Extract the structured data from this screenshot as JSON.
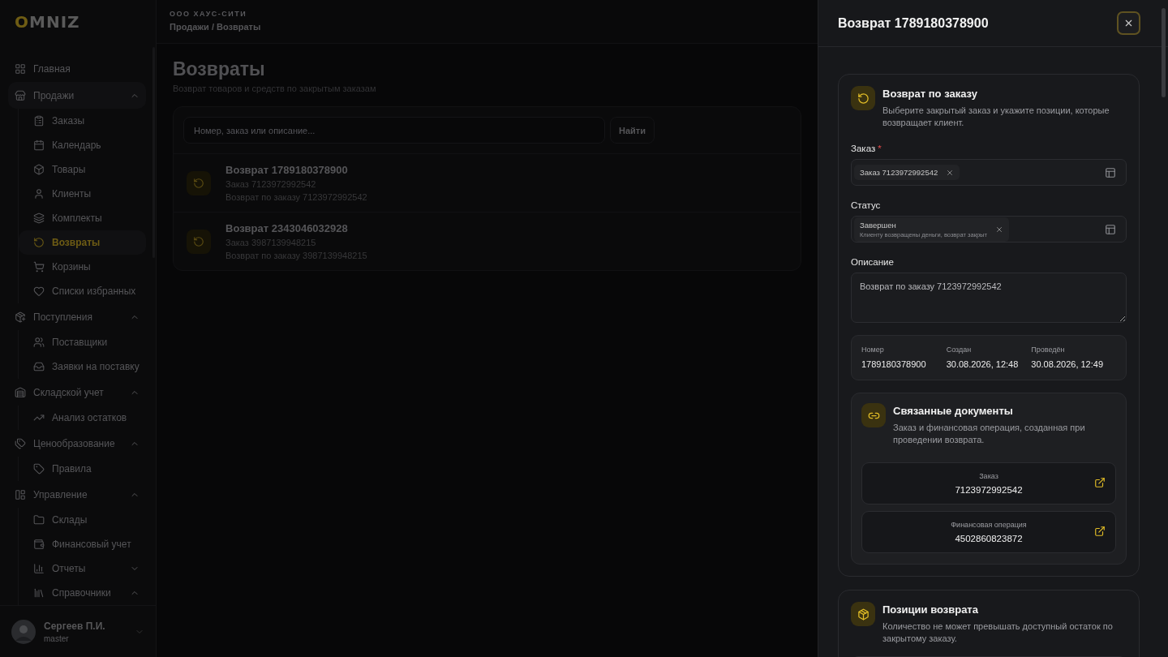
{
  "logo": {
    "accent": "O",
    "rest": "MNIZ"
  },
  "sidebar": {
    "items": [
      {
        "label": "Главная",
        "selected": false
      },
      {
        "label": "Продажи",
        "selected": false,
        "expanded": true,
        "children": [
          {
            "label": "Заказы",
            "selected": false
          },
          {
            "label": "Календарь",
            "selected": false
          },
          {
            "label": "Товары",
            "selected": false
          },
          {
            "label": "Клиенты",
            "selected": false
          },
          {
            "label": "Комплекты",
            "selected": false
          },
          {
            "label": "Возвраты",
            "selected": true
          },
          {
            "label": "Корзины",
            "selected": false
          },
          {
            "label": "Списки избранных",
            "selected": false
          }
        ]
      },
      {
        "label": "Поступления",
        "selected": false,
        "expanded": true,
        "children": [
          {
            "label": "Поставщики",
            "selected": false
          },
          {
            "label": "Заявки на поставку",
            "selected": false
          }
        ]
      },
      {
        "label": "Складской учет",
        "selected": false,
        "expanded": true,
        "children": [
          {
            "label": "Анализ остатков",
            "selected": false
          }
        ]
      },
      {
        "label": "Ценообразование",
        "selected": false,
        "expanded": true,
        "children": [
          {
            "label": "Правила",
            "selected": false
          }
        ]
      },
      {
        "label": "Управление",
        "selected": false,
        "expanded": true,
        "children": [
          {
            "label": "Склады",
            "selected": false
          },
          {
            "label": "Финансовый учет",
            "selected": false
          },
          {
            "label": "Отчеты",
            "selected": false,
            "expanded": false
          },
          {
            "label": "Справочники",
            "selected": false,
            "expanded": true
          }
        ]
      }
    ]
  },
  "user": {
    "name": "Сергеев П.И.",
    "role": "master"
  },
  "header": {
    "company": "ООО ХАУС-СИТИ",
    "breadcrumb": "Продажи / Возвраты"
  },
  "page": {
    "title": "Возвраты",
    "subtitle": "Возврат товаров и средств по закрытым заказам"
  },
  "search": {
    "placeholder": "Номер, заказ или описание...",
    "button": "Найти"
  },
  "returns": [
    {
      "title": "Возврат 1789180378900",
      "order": "Заказ 7123972992542",
      "description": "Возврат по заказу 7123972992542"
    },
    {
      "title": "Возврат 2343046032928",
      "order": "Заказ 3987139948215",
      "description": "Возврат по заказу 3987139948215"
    }
  ],
  "drawer": {
    "title": "Возврат 1789180378900",
    "section": {
      "title": "Возврат по заказу",
      "subtitle": "Выберите закрытый заказ и укажите позиции, которые возвращает клиент.",
      "order_label": "Заказ",
      "required_mark": "*",
      "order_chip": "Заказ 7123972992542",
      "status_label": "Статус",
      "status_chip": {
        "title": "Завершен",
        "subtitle": "Клиенту возвращены деньги, возврат закрыт"
      },
      "description_label": "Описание",
      "description_value": "Возврат по заказу 7123972992542",
      "meta": [
        {
          "label": "Номер",
          "value": "1789180378900"
        },
        {
          "label": "Создан",
          "value": "30.08.2026, 12:48"
        },
        {
          "label": "Проведён",
          "value": "30.08.2026, 12:49"
        }
      ],
      "linked": {
        "title": "Связанные документы",
        "subtitle": "Заказ и финансовая операция, созданная при проведении возврата.",
        "documents": [
          {
            "label": "Заказ",
            "value": "7123972992542"
          },
          {
            "label": "Финансовая операция",
            "value": "4502860823872"
          }
        ]
      }
    },
    "positions": {
      "title": "Позиции возврата",
      "subtitle": "Количество не может превышать доступный остаток по закрытому заказу."
    }
  }
}
